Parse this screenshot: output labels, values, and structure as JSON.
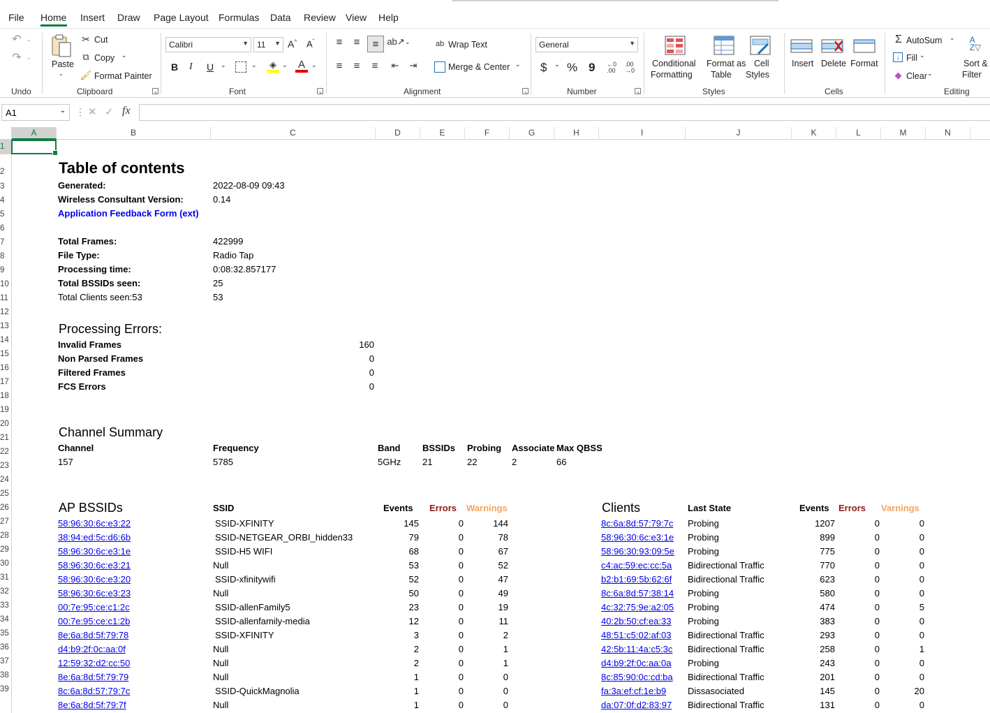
{
  "menu": [
    "File",
    "Home",
    "Insert",
    "Draw",
    "Page Layout",
    "Formulas",
    "Data",
    "Review",
    "View",
    "Help"
  ],
  "ribbon": {
    "undo_group": "Undo",
    "clipboard": {
      "paste": "Paste",
      "cut": "Cut",
      "copy": "Copy",
      "format_painter": "Format Painter",
      "group": "Clipboard"
    },
    "font": {
      "name": "Calibri",
      "size": "11",
      "group": "Font",
      "bold": "B",
      "italic": "I",
      "underline": "U"
    },
    "alignment": {
      "wrap_text": "Wrap Text",
      "merge_center": "Merge & Center",
      "group": "Alignment"
    },
    "number": {
      "format": "General",
      "currency": "$",
      "percent": "%",
      "comma": "9",
      "group": "Number"
    },
    "styles": {
      "conditional": "Conditional",
      "conditional2": "Formatting",
      "format_table": "Format as",
      "format_table2": "Table",
      "cell_styles": "Cell",
      "cell_styles2": "Styles",
      "group": "Styles"
    },
    "cells": {
      "insert": "Insert",
      "delete": "Delete",
      "format": "Format",
      "group": "Cells"
    },
    "editing": {
      "autosum": "AutoSum",
      "fill": "Fill",
      "clear": "Clear",
      "sort": "Sort &",
      "sort2": "Filter",
      "group": "Editing"
    }
  },
  "formula_bar": {
    "name_box": "A1",
    "fx": "fx",
    "value": ""
  },
  "columns": [
    "A",
    "B",
    "C",
    "D",
    "E",
    "F",
    "G",
    "H",
    "I",
    "J",
    "K",
    "L",
    "M",
    "N"
  ],
  "rows": [
    "1",
    "2",
    "3",
    "4",
    "5",
    "6",
    "7",
    "8",
    "9",
    "10",
    "11",
    "12",
    "13",
    "14",
    "15",
    "16",
    "17",
    "18",
    "19",
    "20",
    "21",
    "22",
    "23",
    "24",
    "25",
    "26",
    "27",
    "28",
    "29",
    "30",
    "31",
    "32",
    "33",
    "34",
    "35",
    "36",
    "37",
    "38",
    "39"
  ],
  "sheet": {
    "title": "Table of contents",
    "generated_label": "Generated:",
    "generated_value": "2022-08-09 09:43",
    "version_label": "Wireless Consultant Version:",
    "version_value": "0.14",
    "feedback_link": "Application Feedback Form (ext)",
    "stats": [
      {
        "label": "Total Frames:",
        "value": "422999",
        "bold": true
      },
      {
        "label": "File Type:",
        "value": "Radio Tap",
        "bold": true
      },
      {
        "label": "Processing time:",
        "value": "0:08:32.857177",
        "bold": true
      },
      {
        "label": "Total BSSIDs seen:",
        "value": "25",
        "bold": true
      },
      {
        "label": "Total Clients seen:53",
        "value": "53",
        "bold": false
      }
    ],
    "errors_title": "Processing Errors:",
    "errors": [
      {
        "label": "Invalid Frames",
        "value": "160"
      },
      {
        "label": "Non Parsed Frames",
        "value": "0"
      },
      {
        "label": "Filtered Frames",
        "value": "0"
      },
      {
        "label": "FCS Errors",
        "value": "0"
      }
    ],
    "channel_title": "Channel Summary",
    "channel_headers": [
      "Channel",
      "Frequency",
      "Band",
      "BSSIDs",
      "Probing",
      "Associate",
      "Max QBSS"
    ],
    "channel_row": [
      "157",
      "5785",
      "5GHz",
      "21",
      "22",
      "2",
      "66"
    ],
    "ap_title": "AP BSSIDs",
    "ap_headers": {
      "ssid": "SSID",
      "events": "Events",
      "errors": "Errors",
      "warnings": "Warnings"
    },
    "ap_rows": [
      [
        "58:96:30:6c:e3:22",
        "SSID-XFINITY",
        "145",
        "0",
        "144"
      ],
      [
        "38:94:ed:5c:d6:6b",
        "SSID-NETGEAR_ORBI_hidden33",
        "79",
        "0",
        "78"
      ],
      [
        "58:96:30:6c:e3:1e",
        "SSID-H5 WIFI",
        "68",
        "0",
        "67"
      ],
      [
        "58:96:30:6c:e3:21",
        "Null",
        "53",
        "0",
        "52"
      ],
      [
        "58:96:30:6c:e3:20",
        "SSID-xfinitywifi",
        "52",
        "0",
        "47"
      ],
      [
        "58:96:30:6c:e3:23",
        "Null",
        "50",
        "0",
        "49"
      ],
      [
        "00:7e:95:ce:c1:2c",
        "SSID-allenFamily5",
        "23",
        "0",
        "19"
      ],
      [
        "00:7e:95:ce:c1:2b",
        "SSID-allenfamily-media",
        "12",
        "0",
        "11"
      ],
      [
        "8e:6a:8d:5f:79:78",
        "SSID-XFINITY",
        "3",
        "0",
        "2"
      ],
      [
        "d4:b9:2f:0c:aa:0f",
        "Null",
        "2",
        "0",
        "1"
      ],
      [
        "12:59:32:d2:cc:50",
        "Null",
        "2",
        "0",
        "1"
      ],
      [
        "8e:6a:8d:5f:79:79",
        "Null",
        "1",
        "0",
        "0"
      ],
      [
        "8c:6a:8d:57:79:7c",
        "SSID-QuickMagnolia",
        "1",
        "0",
        "0"
      ],
      [
        "8e:6a:8d:5f:79:7f",
        "Null",
        "1",
        "0",
        "0"
      ]
    ],
    "clients_title": "Clients",
    "client_headers": {
      "last_state": "Last State",
      "events": "Events",
      "errors": "Errors",
      "warnings": "Varnings"
    },
    "client_rows": [
      [
        "8c:6a:8d:57:79:7c",
        "Probing",
        "1207",
        "0",
        "0"
      ],
      [
        "58:96:30:6c:e3:1e",
        "Probing",
        "899",
        "0",
        "0"
      ],
      [
        "58:96:30:93:09:5e",
        "Probing",
        "775",
        "0",
        "0"
      ],
      [
        "c4:ac:59:ec:cc:5a",
        "Bidirectional Traffic",
        "770",
        "0",
        "0"
      ],
      [
        "b2:b1:69:5b:62:6f",
        "Bidirectional Traffic",
        "623",
        "0",
        "0"
      ],
      [
        "8c:6a:8d:57:38:14",
        "Probing",
        "580",
        "0",
        "0"
      ],
      [
        "4c:32:75:9e:a2:05",
        "Probing",
        "474",
        "0",
        "5"
      ],
      [
        "40:2b:50:cf:ea:33",
        "Probing",
        "383",
        "0",
        "0"
      ],
      [
        "48:51:c5:02:af:03",
        "Bidirectional Traffic",
        "293",
        "0",
        "0"
      ],
      [
        "42:5b:11:4a:c5:3c",
        "Bidirectional Traffic",
        "258",
        "0",
        "1"
      ],
      [
        "d4:b9:2f:0c:aa:0a",
        "Probing",
        "243",
        "0",
        "0"
      ],
      [
        "8c:85:90:0c:cd:ba",
        "Bidirectional Traffic",
        "201",
        "0",
        "0"
      ],
      [
        "fa:3a:ef:cf:1e:b9",
        "Dissasociated",
        "145",
        "0",
        "20"
      ],
      [
        "da:07:0f:d2:83:97",
        "Bidirectional Traffic",
        "131",
        "0",
        "0"
      ]
    ]
  }
}
